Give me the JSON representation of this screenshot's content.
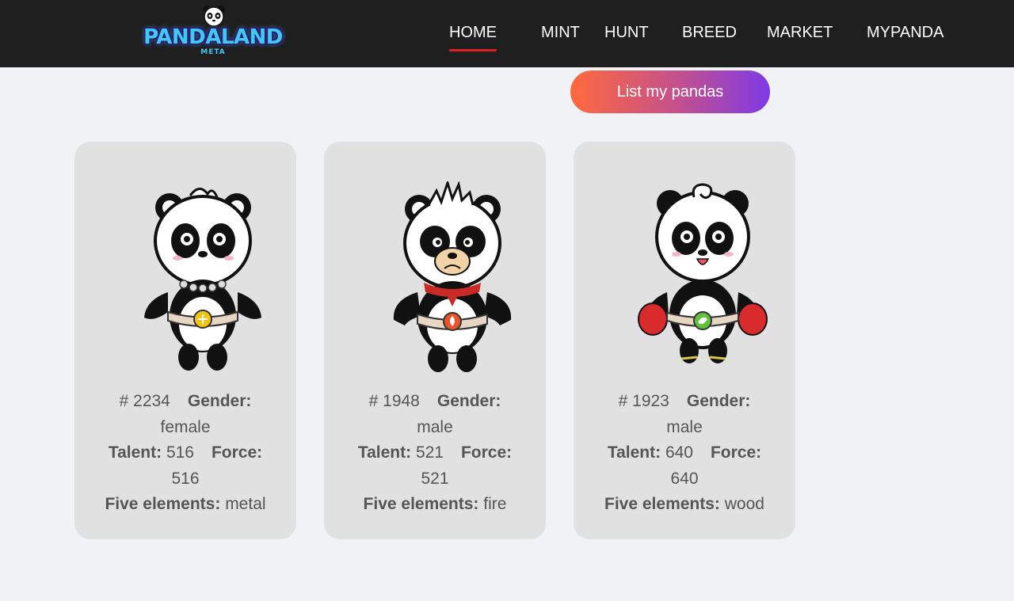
{
  "brand": {
    "name": "PANDALAND",
    "sub": "META"
  },
  "nav": {
    "home": "HOME",
    "mint": "MINT",
    "hunt": "HUNT",
    "breed": "BREED",
    "market": "MARKET",
    "mypanda": "MYPANDA"
  },
  "list_button": "List my pandas",
  "labels": {
    "gender": "Gender:",
    "talent": "Talent:",
    "force": "Force:",
    "five_elements": "Five elements:"
  },
  "pandas": [
    {
      "id": "# 2234",
      "gender": "female",
      "talent": "516",
      "force": "516",
      "element": "metal",
      "element_color": "#f2c511"
    },
    {
      "id": "# 1948",
      "gender": "male",
      "talent": "521",
      "force": "521",
      "element": "fire",
      "element_color": "#e8532a"
    },
    {
      "id": "# 1923",
      "gender": "male",
      "talent": "640",
      "force": "640",
      "element": "wood",
      "element_color": "#5fc23a"
    }
  ],
  "colors": {
    "nav_bg": "#1f1f1f",
    "active_underline": "#e0201c",
    "card_bg": "#e1e1e1",
    "page_bg": "#f0f2f5"
  }
}
